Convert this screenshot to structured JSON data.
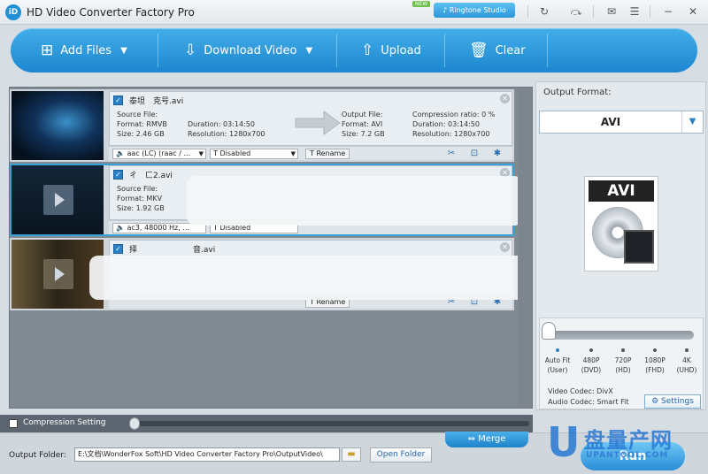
{
  "window": {
    "logo_text": "iD",
    "title": "HD Video Converter Factory Pro",
    "new_badge": "NEW",
    "ringtone_label": "Ringtone Studio",
    "icons": [
      "refresh-icon",
      "skip-icon",
      "feedback-icon",
      "menu-icon",
      "minimize-icon",
      "close-icon"
    ]
  },
  "toolbar": {
    "add_files": "Add Files",
    "download_video": "Download Video",
    "upload": "Upload",
    "clear": "Clear"
  },
  "items": [
    {
      "filename": "泰坦　克号.avi",
      "source_file_label": "Source File:",
      "source_format": "Format: RMVB",
      "source_size": "Size: 2.46 GB",
      "source_duration": "Duration: 03:14:50",
      "source_resolution": "Resolution: 1280x700",
      "output_file_label": "Output File:",
      "output_format": "Format: AVI",
      "output_size": "Size: 7.2 GB",
      "compression": "Compression ratio: 0 %",
      "output_duration": "Duration: 03:14:50",
      "output_resolution": "Resolution: 1280x700",
      "audio": "aac (LC) (raac / ...",
      "subtitle": "Disabled",
      "rename": "Rename"
    },
    {
      "filename": "ㄔ　ㄈ2.avi",
      "source_file_label": "Source File:",
      "source_format": "Format: MKV",
      "source_size": "Size: 1.92 GB",
      "audio": "ac3, 48000 Hz, ...",
      "subtitle": "Disabled"
    },
    {
      "filename": "择　　　　　　　音.avi",
      "rename": "Rename"
    }
  ],
  "right_panel": {
    "output_format_label": "Output Format:",
    "format_value": "AVI",
    "format_icon_label": "AVI",
    "quality_labels": [
      {
        "top": "Auto Fit",
        "bottom": "(User)"
      },
      {
        "top": "480P",
        "bottom": "(DVD)"
      },
      {
        "top": "720P",
        "bottom": "(HD)"
      },
      {
        "top": "1080P",
        "bottom": "(FHD)"
      },
      {
        "top": "4K",
        "bottom": "(UHD)"
      }
    ],
    "video_codec": "Video Codec: DivX",
    "audio_codec": "Audio Codec: Smart Fit",
    "settings_label": "Settings"
  },
  "compression": {
    "label": "Compression Setting",
    "value_percent": 0
  },
  "bottom": {
    "output_folder_label": "Output Folder:",
    "output_path": "E:\\文档\\WonderFox Soft\\HD Video Converter Factory Pro\\OutputVideo\\",
    "open_folder": "Open Folder",
    "merge": "Merge",
    "run": "Run"
  },
  "watermark": {
    "letter": "U",
    "cn": "盘量产网",
    "url": "UPANTOOL.COM"
  }
}
